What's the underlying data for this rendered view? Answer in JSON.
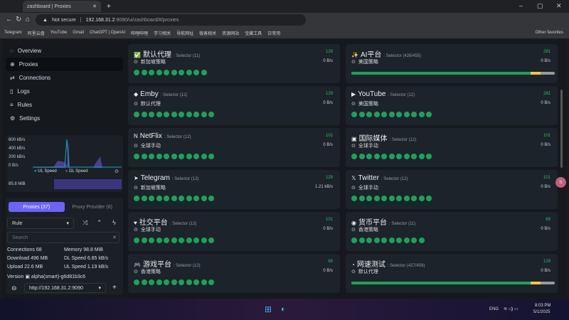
{
  "browser": {
    "tab_title": "zashboard | Proxies",
    "url_warning": "Not secure",
    "url_host": "192.168.31.2",
    "url_rest": ":9090/ui/zashboard/#/proxies",
    "bookmarks": [
      "Telegram",
      "阿里云盘",
      "YouTube",
      "Gmail",
      "ChatGPT | OpenAI",
      "哔哩哔哩",
      "学习相关",
      "导航网址",
      "极客相关",
      "资源网站",
      "宝藏工具",
      "日常用"
    ],
    "other_favorites": "Other favorites"
  },
  "sidebar": {
    "items": [
      {
        "label": "Overview",
        "icon": "dashboard-icon"
      },
      {
        "label": "Proxies",
        "icon": "globe-icon",
        "active": true
      },
      {
        "label": "Connections",
        "icon": "arrows-icon"
      },
      {
        "label": "Logs",
        "icon": "file-icon"
      },
      {
        "label": "Rules",
        "icon": "rules-icon"
      },
      {
        "label": "Settings",
        "icon": "gear-icon"
      }
    ],
    "chart": {
      "yticks": [
        "600 kB/s",
        "400 kB/s",
        "200 kB/s",
        "0 B/s"
      ],
      "legend_ul": "UL Speed",
      "legend_dl": "DL Speed",
      "memory": "85.8 MiB"
    },
    "tabs": {
      "proxies": "Proxies (37)",
      "provider": "Proxy Provider (6)"
    },
    "mode": "Rule",
    "search_placeholder": "Search",
    "stats": {
      "connections_label": "Connections",
      "connections": "68",
      "memory_label": "Memory",
      "memory": "98.8 MiB",
      "download_label": "Download",
      "download": "496 MB",
      "dl_speed_label": "DL Speed",
      "dl_speed": "6.85 kB/s",
      "upload_label": "Upload",
      "upload": "22.6 MB",
      "ul_speed_label": "UL Speed",
      "ul_speed": "1.19 kB/s",
      "version_label": "Version",
      "version": "alpha(smart)-g6d81b3c6"
    },
    "endpoint": "http://192.168.31.2:9090"
  },
  "groups": [
    {
      "name": "默认代理",
      "type": ": Selector (11)",
      "latency": "129",
      "now": "新加坡策略",
      "speed": "0 B/s",
      "dots": 11,
      "selected": 2,
      "icon": "✅"
    },
    {
      "name": "AI平台",
      "type": ": Selector (426/455)",
      "latency": "281",
      "now": "美国策略",
      "speed": "0 B/s",
      "bar": [
        88,
        5
      ],
      "icon": "✨"
    },
    {
      "name": "Emby",
      "type": ": Selector (12)",
      "latency": "129",
      "now": "默认代理",
      "speed": "0 B/s",
      "dots": 12,
      "selected": 0,
      "icon": "◆"
    },
    {
      "name": "YouTube",
      "type": ": Selector (12)",
      "latency": "281",
      "now": "美国策略",
      "speed": "0 B/s",
      "dots": 12,
      "selected": 6,
      "icon": "▶"
    },
    {
      "name": "NetFlix",
      "type": ": Selector (12)",
      "latency": "101",
      "now": "全球手动",
      "speed": "0 B/s",
      "dots": 12,
      "selected": 10,
      "icon": "N"
    },
    {
      "name": "国际媒体",
      "type": ": Selector (12)",
      "latency": "101",
      "now": "全球手动",
      "speed": "0 B/s",
      "dots": 12,
      "selected": 10,
      "icon": "▣"
    },
    {
      "name": "Telegram",
      "type": ": Selector (12)",
      "latency": "129",
      "now": "新加坡策略",
      "speed": "1.21 kB/s",
      "dots": 12,
      "selected": 3,
      "icon": "➤"
    },
    {
      "name": "Twitter",
      "type": ": Selector (12)",
      "latency": "101",
      "now": "全球手动",
      "speed": "0 B/s",
      "dots": 12,
      "selected": 10,
      "icon": "𝕏"
    },
    {
      "name": "社交平台",
      "type": ": Selector (12)",
      "latency": "101",
      "now": "全球手动",
      "speed": "0 B/s",
      "dots": 12,
      "selected": 10,
      "icon": "♥"
    },
    {
      "name": "货币平台",
      "type": ": Selector (11)",
      "latency": "69",
      "now": "香港策略",
      "speed": "0 B/s",
      "dots": 11,
      "selected": 2,
      "icon": "◉"
    },
    {
      "name": "游戏平台",
      "type": ": Selector (12)",
      "latency": "69",
      "now": "香港策略",
      "speed": "0 B/s",
      "dots": 12,
      "selected": 2,
      "icon": "🎮"
    },
    {
      "name": "网速测试",
      "type": ": Selector (427/456)",
      "latency": "129",
      "now": "默认代理",
      "speed": "0 B/s",
      "bar": [
        88,
        5
      ],
      "icon": "◔"
    }
  ],
  "colors": {
    "accent": "#6c63ff",
    "latency_good": "#2ebf62",
    "dot": "#1aa35a",
    "bar_warn": "#f5c542"
  },
  "taskbar": {
    "lang": "ENG",
    "time": "8:03 PM",
    "date": "5/1/2025"
  }
}
